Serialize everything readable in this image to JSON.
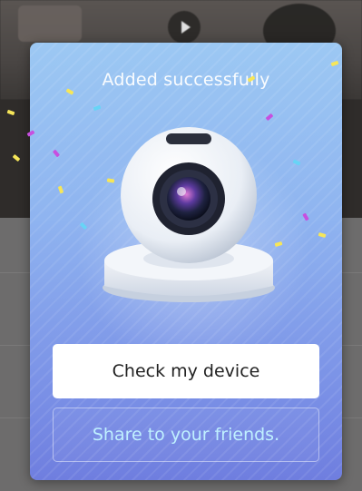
{
  "dialog": {
    "title": "Added successfully",
    "primary_button": "Check my device",
    "secondary_button": "Share to your friends."
  },
  "colors": {
    "card_top": "#9cc8f3",
    "card_bottom": "#6f7edf",
    "secondary_text": "#bff0ff",
    "primary_text": "#222222"
  },
  "icons": {
    "illustration": "camera-icon",
    "background_play": "play-icon"
  }
}
